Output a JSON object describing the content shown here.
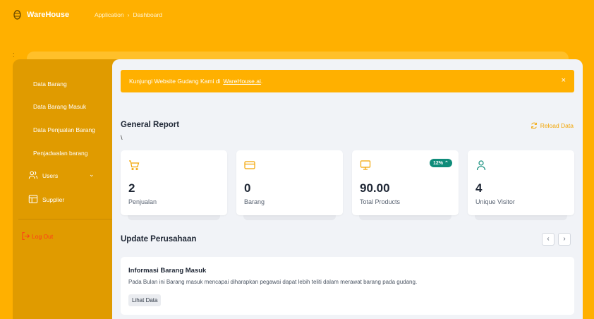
{
  "header": {
    "app_name": "WareHouse",
    "breadcrumb": [
      "Application",
      "Dashboard"
    ]
  },
  "sidebar": {
    "items": [
      {
        "label": "Data Barang"
      },
      {
        "label": "Data Barang Masuk"
      },
      {
        "label": "Data Penjualan Barang"
      },
      {
        "label": "Penjadwalan barang"
      },
      {
        "label": "Users",
        "icon": "users-icon",
        "has_submenu": true
      },
      {
        "label": "Supplier",
        "icon": "table-icon"
      }
    ],
    "logout_label": "Log Out"
  },
  "alert": {
    "text": "Kunjungi Website Gudang Kami di",
    "link_text": "WareHouse.ai",
    "link_suffix": ".",
    "close_glyph": "×"
  },
  "general_report": {
    "title": "General Report",
    "stray_text": "\\",
    "reload_label": "Reload Data",
    "cards": [
      {
        "icon": "shopping-cart-icon",
        "value": "2",
        "label": "Penjualan"
      },
      {
        "icon": "credit-card-icon",
        "value": "0",
        "label": "Barang"
      },
      {
        "icon": "monitor-icon",
        "value": "90.00",
        "label": "Total Products",
        "badge": "12%"
      },
      {
        "icon": "user-icon",
        "value": "4",
        "label": "Unique Visitor"
      }
    ]
  },
  "updates": {
    "title": "Update Perusahaan",
    "prev_glyph": "‹",
    "next_glyph": "›",
    "card": {
      "title": "Informasi Barang Masuk",
      "description": "Pada Bulan ini Barang masuk mencapai diharapkan pegawai dapat lebih teliti dalam merawat barang pada gudang.",
      "button_label": "Lihat Data"
    }
  },
  "colors": {
    "brand": "#ffb000",
    "sidebar": "#e09b00",
    "background": "#f1f3f7",
    "badge": "#0f8c7a",
    "logout": "#ff3b1a",
    "icon_accent": "#f2a400",
    "icon_teal": "#0f8c7a"
  }
}
